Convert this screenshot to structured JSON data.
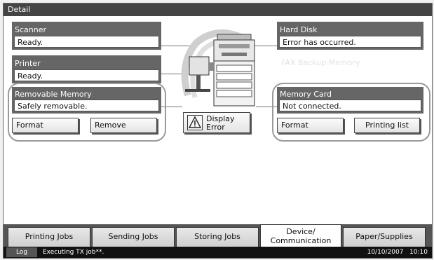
{
  "window": {
    "title": "Detail"
  },
  "scanner": {
    "label": "Scanner",
    "status": "Ready."
  },
  "printer": {
    "label": "Printer",
    "status": "Ready."
  },
  "hard_disk": {
    "label": "Hard Disk",
    "status": "Error has occurred."
  },
  "fax_backup": {
    "label": "FAX Backup Memory"
  },
  "removable_memory": {
    "label": "Removable Memory",
    "status": "Safely removable.",
    "format_label": "Format",
    "remove_label": "Remove"
  },
  "memory_card": {
    "label": "Memory Card",
    "status": "Not connected.",
    "format_label": "Format",
    "printing_list_label": "Printing list"
  },
  "display_error": {
    "label_line1": "Display",
    "label_line2": "Error",
    "icon": "warning-icon"
  },
  "tabs": [
    {
      "label": "Printing Jobs"
    },
    {
      "label": "Sending Jobs"
    },
    {
      "label": "Storing Jobs"
    },
    {
      "label_line1": "Device/",
      "label_line2": "Communication"
    },
    {
      "label": "Paper/Supplies"
    }
  ],
  "status_bar": {
    "log_label": "Log",
    "message": "Executing TX job**.",
    "datetime": "10/10/2007   10:10"
  },
  "colors": {
    "panel": "#666666",
    "titlebar": "#444444",
    "statusbar": "#111111",
    "group_border": "#9a9a9a"
  }
}
